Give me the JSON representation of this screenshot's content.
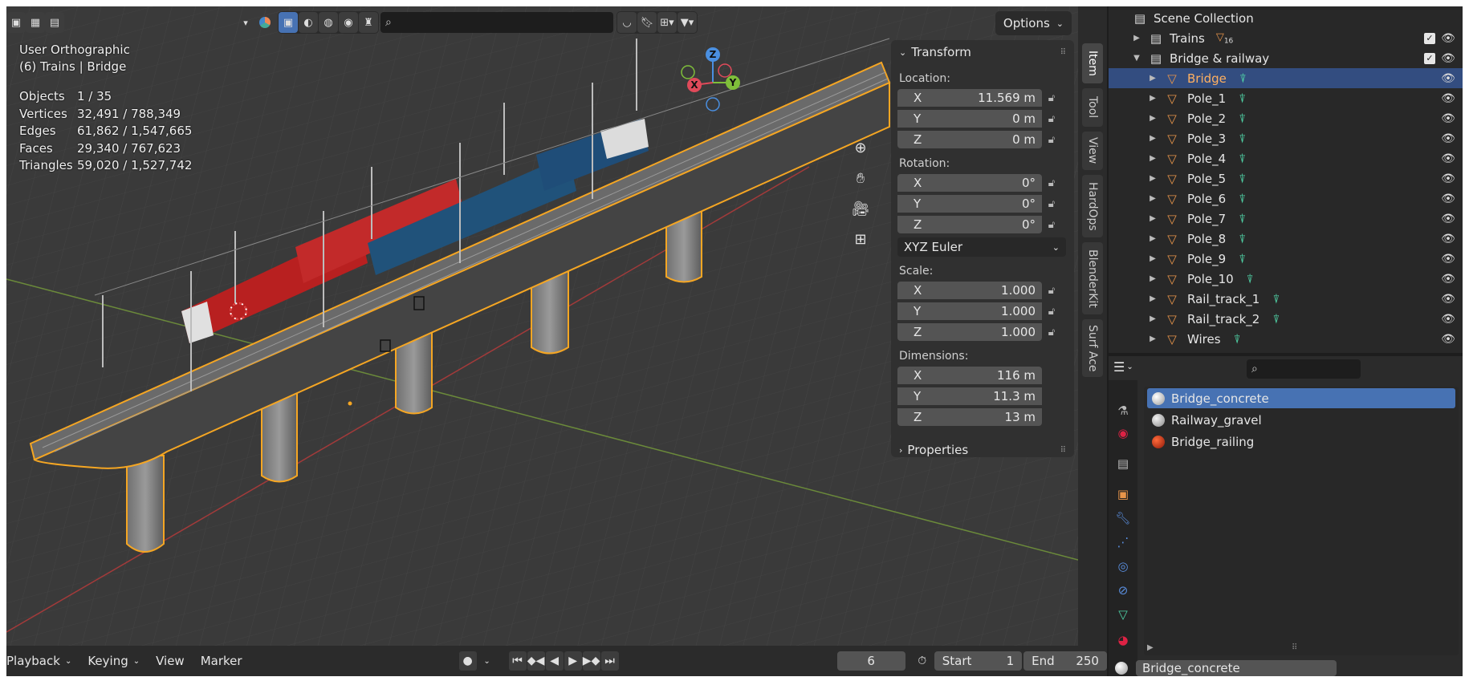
{
  "viewport": {
    "view_name": "User Orthographic",
    "context": "(6) Trains | Bridge",
    "options_label": "Options",
    "stats": [
      {
        "label": "Objects",
        "value": "1 / 35"
      },
      {
        "label": "Vertices",
        "value": "32,491 / 788,349"
      },
      {
        "label": "Edges",
        "value": "61,862 / 1,547,665"
      },
      {
        "label": "Faces",
        "value": "29,340 / 767,623"
      },
      {
        "label": "Triangles",
        "value": "59,020 / 1,527,742"
      }
    ],
    "gizmo": {
      "x": "X",
      "y": "Y",
      "z": "Z"
    }
  },
  "npanel": {
    "header": "Transform",
    "location_label": "Location:",
    "location": [
      {
        "axis": "X",
        "value": "11.569 m"
      },
      {
        "axis": "Y",
        "value": "0 m"
      },
      {
        "axis": "Z",
        "value": "0 m"
      }
    ],
    "rotation_label": "Rotation:",
    "rotation": [
      {
        "axis": "X",
        "value": "0°"
      },
      {
        "axis": "Y",
        "value": "0°"
      },
      {
        "axis": "Z",
        "value": "0°"
      }
    ],
    "rotation_mode": "XYZ Euler",
    "scale_label": "Scale:",
    "scale": [
      {
        "axis": "X",
        "value": "1.000"
      },
      {
        "axis": "Y",
        "value": "1.000"
      },
      {
        "axis": "Z",
        "value": "1.000"
      }
    ],
    "dimensions_label": "Dimensions:",
    "dimensions": [
      {
        "axis": "X",
        "value": "116 m"
      },
      {
        "axis": "Y",
        "value": "11.3 m"
      },
      {
        "axis": "Z",
        "value": "13 m"
      }
    ],
    "properties_label": "Properties"
  },
  "side_tabs": [
    "Item",
    "Tool",
    "View",
    "HardOps",
    "BlenderKit",
    "Surf Ace"
  ],
  "timeline": {
    "playback": "Playback",
    "keying": "Keying",
    "view": "View",
    "marker": "Marker",
    "current_frame": "6",
    "start_label": "Start",
    "start": "1",
    "end_label": "End",
    "end": "250"
  },
  "outliner": {
    "root": "Scene Collection",
    "trains": "Trains",
    "trains_count": "16",
    "bridge_collection": "Bridge & railway",
    "objects": [
      "Bridge",
      "Pole_1",
      "Pole_2",
      "Pole_3",
      "Pole_4",
      "Pole_5",
      "Pole_6",
      "Pole_7",
      "Pole_8",
      "Pole_9",
      "Pole_10",
      "Rail_track_1",
      "Rail_track_2",
      "Wires"
    ],
    "selected": "Bridge"
  },
  "materials": {
    "items": [
      {
        "name": "Bridge_concrete",
        "color": "#d8d8d8"
      },
      {
        "name": "Railway_gravel",
        "color": "#bdbdbd"
      },
      {
        "name": "Bridge_railing",
        "color": "#d23a1e"
      }
    ],
    "selected": "Bridge_concrete",
    "slot_name": "Bridge_concrete"
  },
  "colors": {
    "accent": "#4772b3",
    "selection_outline": "#f5a623",
    "mesh_icon": "#4fd1a5",
    "object_icon": "#e8954a"
  }
}
